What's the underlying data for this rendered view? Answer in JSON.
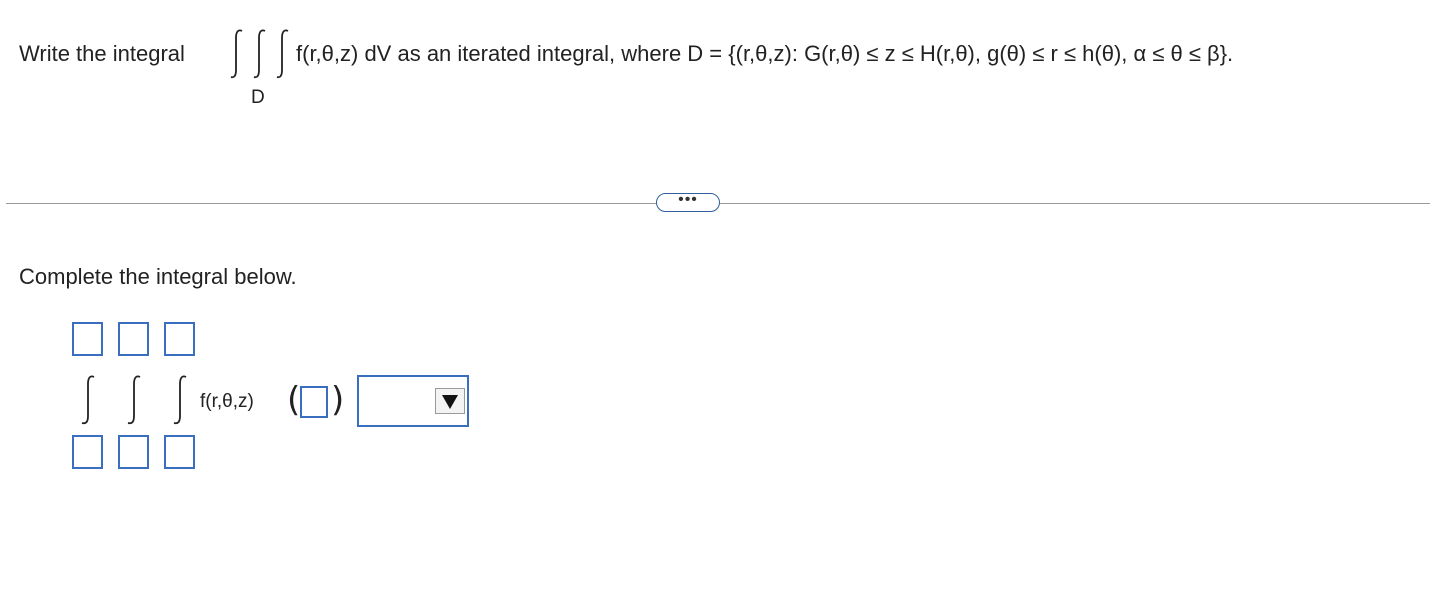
{
  "question": {
    "prefix": "Write the integral",
    "integral_symbols": "∫∫∫",
    "region_label": "D",
    "integrand_text": "f(r,θ,z) dV as an iterated integral, where D = {(r,θ,z): G(r,θ) ≤ z ≤ H(r,θ), g(θ) ≤ r ≤ h(θ), α ≤ θ ≤ β}."
  },
  "divider": {
    "more_label": "•••"
  },
  "answer": {
    "instruction": "Complete the integral below.",
    "integral_sign": "∫",
    "integrand": "f(r,θ,z)",
    "open_paren": "(",
    "close_paren": ")",
    "upper_limits": [
      "",
      "",
      ""
    ],
    "lower_limits": [
      "",
      "",
      ""
    ],
    "differential_value": "",
    "dropdown_selected": ""
  },
  "colors": {
    "input_border": "#3a6fc0",
    "divider": "#9a9a9a"
  }
}
